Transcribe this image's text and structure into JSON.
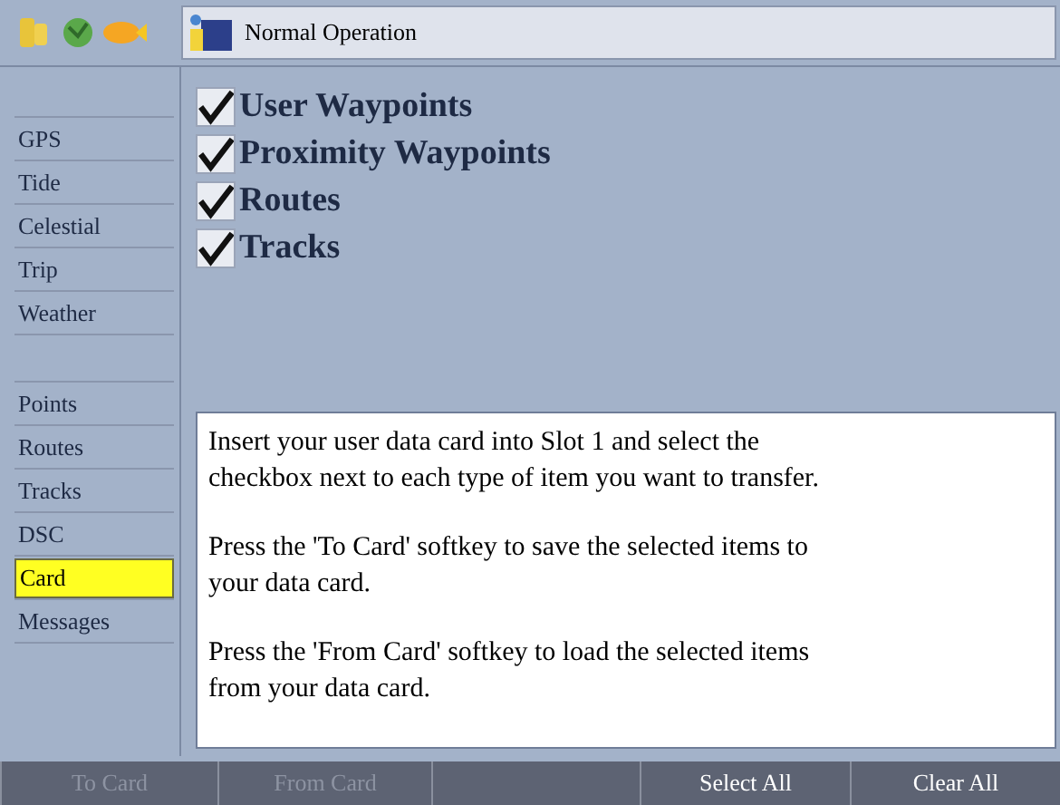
{
  "title_bar": {
    "title": "Normal Operation"
  },
  "sidebar": {
    "items": [
      {
        "kind": "header"
      },
      {
        "kind": "item",
        "label": "GPS",
        "selected": false
      },
      {
        "kind": "item",
        "label": "Tide",
        "selected": false
      },
      {
        "kind": "item",
        "label": "Celestial",
        "selected": false
      },
      {
        "kind": "item",
        "label": "Trip",
        "selected": false
      },
      {
        "kind": "item",
        "label": "Weather",
        "selected": false
      },
      {
        "kind": "header"
      },
      {
        "kind": "item",
        "label": "Points",
        "selected": false
      },
      {
        "kind": "item",
        "label": "Routes",
        "selected": false
      },
      {
        "kind": "item",
        "label": "Tracks",
        "selected": false
      },
      {
        "kind": "item",
        "label": "DSC",
        "selected": false
      },
      {
        "kind": "item",
        "label": "Card",
        "selected": true
      },
      {
        "kind": "item",
        "label": "Messages",
        "selected": false
      }
    ]
  },
  "options": [
    {
      "label": "User Waypoints",
      "checked": true
    },
    {
      "label": "Proximity Waypoints",
      "checked": true
    },
    {
      "label": "Routes",
      "checked": true
    },
    {
      "label": "Tracks",
      "checked": true
    }
  ],
  "instructions": [
    "Insert your user data card into Slot 1 and select the checkbox next to each type of item you want to transfer.",
    "Press the 'To Card' softkey to save the selected items to your data card.",
    "Press the 'From Card' softkey to load the selected items from your data card."
  ],
  "softkeys": [
    {
      "kind": "key",
      "label": "To Card",
      "disabled": true
    },
    {
      "kind": "key",
      "label": "From Card",
      "disabled": true
    },
    {
      "kind": "blank"
    },
    {
      "kind": "key",
      "label": "Select All",
      "disabled": false
    },
    {
      "kind": "key",
      "label": "Clear All",
      "disabled": false
    }
  ]
}
